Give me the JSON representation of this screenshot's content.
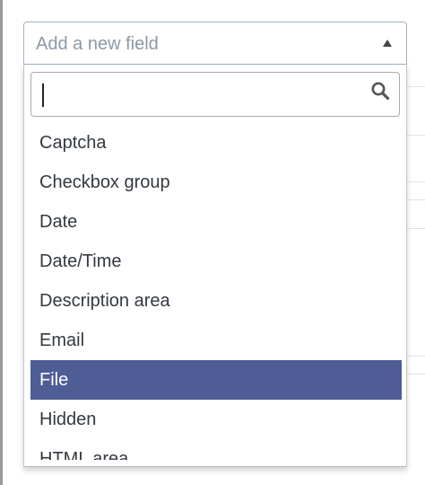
{
  "field_select": {
    "placeholder": "Add a new field"
  },
  "dropdown": {
    "search_value": "",
    "selected_index": 6,
    "options": [
      "Captcha",
      "Checkbox group",
      "Date",
      "Date/Time",
      "Description area",
      "Email",
      "File",
      "Hidden",
      "HTML area"
    ]
  },
  "icons": {
    "search": "search-icon",
    "caret": "caret-up-icon"
  },
  "colors": {
    "selected_bg": "#4e5d96",
    "selected_text": "#ffffff",
    "placeholder_text": "#8b99a6",
    "select_border": "#9fb3c8"
  }
}
